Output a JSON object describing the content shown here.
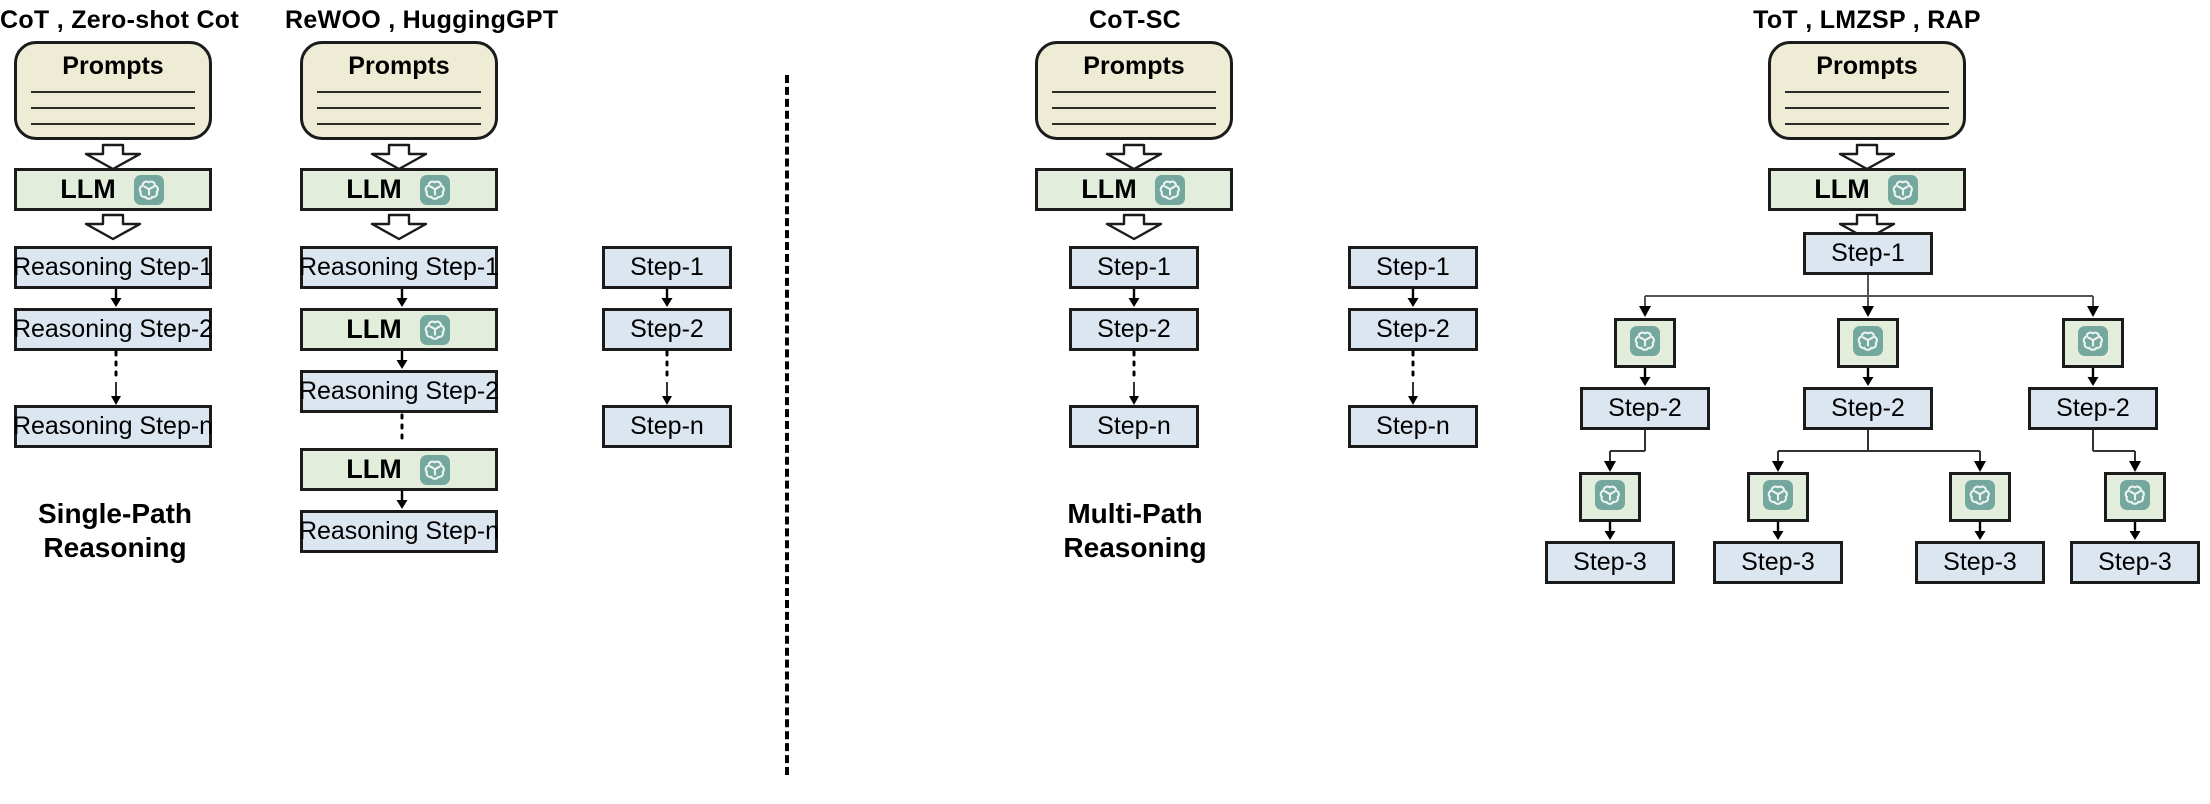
{
  "colors": {
    "prompts_fill": "#EEECD5",
    "llm_fill": "#E2EDDC",
    "step_fill": "#DCE6F1",
    "stroke": "#1b1b1b",
    "openai_logo": "#74A79D"
  },
  "sections": {
    "single_path": {
      "caption": "Single-Path\nReasoning",
      "columns": [
        {
          "title": "CoT , Zero-shot Cot",
          "prompts_label": "Prompts",
          "llm_label": "LLM",
          "steps": [
            "Reasoning Step-1",
            "Reasoning Step-2",
            "Reasoning Step-n"
          ]
        },
        {
          "title": "ReWOO , HuggingGPT",
          "prompts_label": "Prompts",
          "llm_label": "LLM",
          "chain": [
            {
              "kind": "step",
              "label": "Reasoning Step-1"
            },
            {
              "kind": "llm",
              "label": "LLM"
            },
            {
              "kind": "step",
              "label": "Reasoning Step-2"
            },
            {
              "kind": "llm",
              "label": "LLM"
            },
            {
              "kind": "step",
              "label": "Reasoning Step-n"
            }
          ]
        }
      ]
    },
    "multi_path": {
      "caption": "Multi-Path\nReasoning",
      "cot_sc": {
        "title": "CoT-SC",
        "prompts_label": "Prompts",
        "llm_label": "LLM",
        "paths": [
          [
            "Step-1",
            "Step-2",
            "Step-n"
          ],
          [
            "Step-1",
            "Step-2",
            "Step-n"
          ],
          [
            "Step-1",
            "Step-2",
            "Step-n"
          ]
        ]
      },
      "tot": {
        "title": "ToT , LMZSP , RAP",
        "prompts_label": "Prompts",
        "llm_label": "LLM",
        "root_step": "Step-1",
        "level2_steps": [
          "Step-2",
          "Step-2",
          "Step-2"
        ],
        "level3_steps": [
          "Step-3",
          "Step-3",
          "Step-3",
          "Step-3"
        ]
      }
    }
  }
}
